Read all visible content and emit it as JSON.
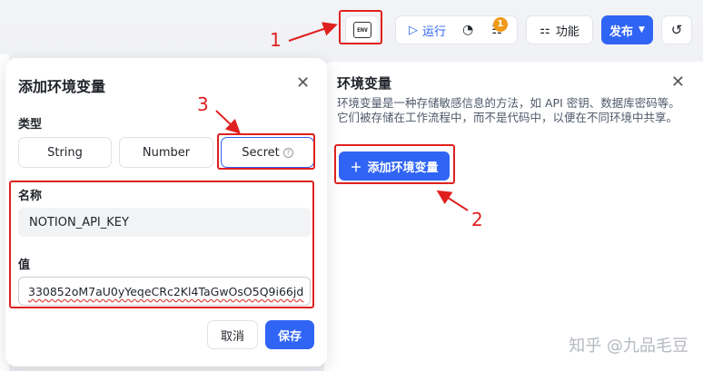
{
  "toolbar": {
    "env_label": "ENV",
    "run_label": "运行",
    "checklist_badge": "1",
    "features_label": "功能",
    "publish_label": "发布"
  },
  "env_panel": {
    "title": "环境变量",
    "description": "环境变量是一种存储敏感信息的方法，如 API 密钥、数据库密码等。它们被存储在工作流程中，而不是代码中，以便在不同环境中共享。",
    "add_button": "添加环境变量"
  },
  "modal": {
    "title": "添加环境变量",
    "type_label": "类型",
    "types": [
      "String",
      "Number",
      "Secret"
    ],
    "selected_type": "Secret",
    "name_label": "名称",
    "name_value": "NOTION_API_KEY",
    "value_label": "值",
    "value_value": "330852oM7aU0yYeqeCRc2Kl4TaGwOsO5Q9i66jd",
    "cancel_button": "取消",
    "save_button": "保存"
  },
  "annotations": [
    "1",
    "2",
    "3"
  ],
  "watermark": "知乎 @九品毛豆",
  "colors": {
    "accent": "#2f64f5",
    "annotation": "#e02020",
    "badge": "#f09a1a"
  }
}
